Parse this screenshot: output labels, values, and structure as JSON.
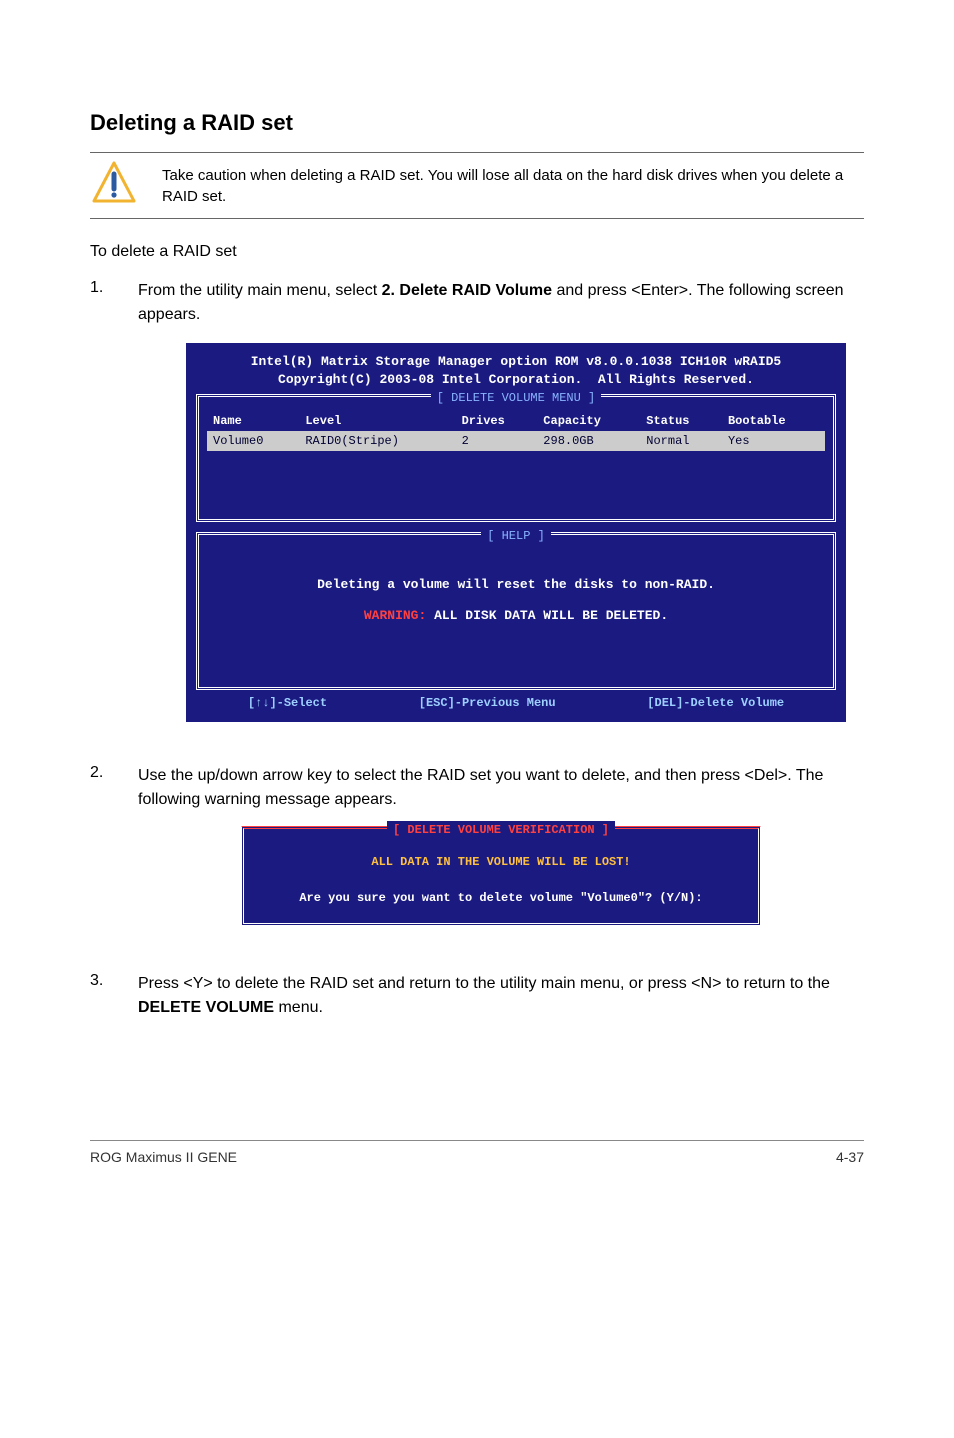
{
  "heading": "Deleting a RAID set",
  "caution": "Take caution when deleting a RAID set. You will lose all data on the hard disk drives when you delete a RAID set.",
  "subheading": "To delete a RAID set",
  "steps": [
    {
      "pre": "From the utility main menu, select ",
      "bold": "2. Delete RAID Volume",
      "post": " and press <Enter>. The following screen appears."
    },
    {
      "pre": "Use the up/down arrow key to select the RAID set you want to delete, and then press <Del>. The following warning message appears.",
      "bold": "",
      "post": ""
    },
    {
      "pre": "Press <Y> to delete the RAID set and return to the utility main menu, or press <N> to return to the ",
      "bold": "DELETE VOLUME",
      "post": " menu."
    }
  ],
  "bios": {
    "title1": "Intel(R) Matrix Storage Manager option ROM v8.0.0.1038 ICH10R wRAID5",
    "title2": "Copyright(C) 2003-08 Intel Corporation.  All Rights Reserved.",
    "delete_menu_label": "[ DELETE VOLUME MENU ]",
    "columns": [
      "Name",
      "Level",
      "Drives",
      "Capacity",
      "Status",
      "Bootable"
    ],
    "row": [
      "Volume0",
      "RAID0(Stripe)",
      "2",
      "298.0GB",
      "Normal",
      "Yes"
    ],
    "help_label": "[ HELP ]",
    "help_line1": "Deleting a volume will reset the disks to non-RAID.",
    "help_warning_prefix": "WARNING:",
    "help_warning_rest": " ALL DISK DATA WILL BE DELETED.",
    "footer": [
      "[↑↓]-Select",
      "[ESC]-Previous Menu",
      "[DEL]-Delete Volume"
    ]
  },
  "verify": {
    "title": "[ DELETE VOLUME VERIFICATION ]",
    "lost": "ALL DATA IN THE VOLUME WILL BE LOST!",
    "prompt": "Are you sure you want to delete volume \"Volume0\"? (Y/N):"
  },
  "footer": {
    "left": "ROG Maximus II GENE",
    "right": "4-37"
  }
}
